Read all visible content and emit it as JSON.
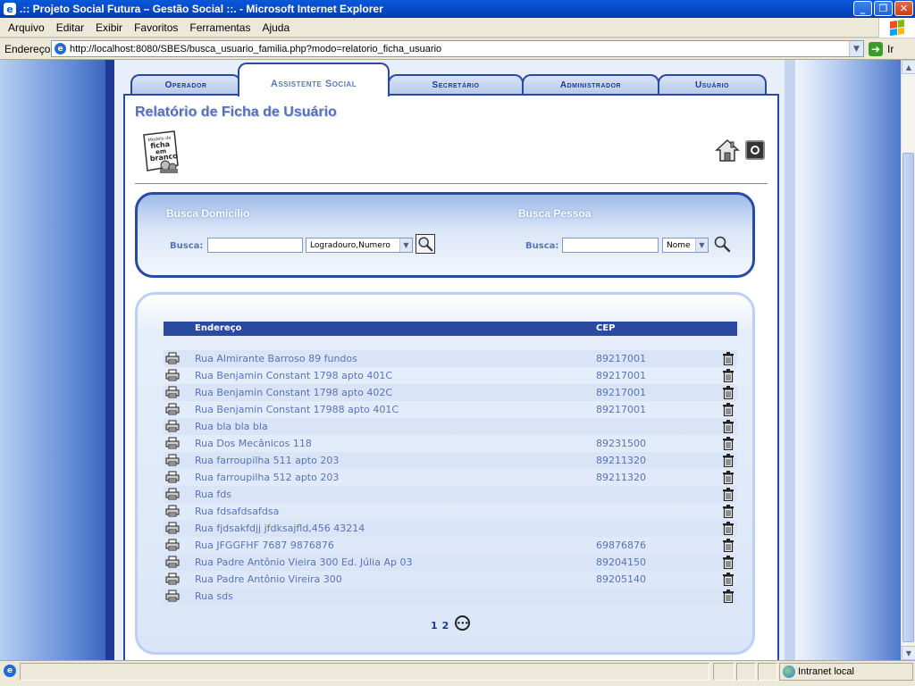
{
  "window": {
    "title": ".:: Projeto Social Futura – Gestão Social ::. - Microsoft Internet Explorer",
    "controls": {
      "minimize": "_",
      "restore": "❐",
      "close": "✕"
    }
  },
  "menu": [
    "Arquivo",
    "Editar",
    "Exibir",
    "Favoritos",
    "Ferramentas",
    "Ajuda"
  ],
  "address": {
    "label": "Endereço",
    "url": "http://localhost:8080/SBES/busca_usuario_familia.php?modo=relatorio_ficha_usuario",
    "go_label": "Ir"
  },
  "tabs": [
    {
      "label": "Operador"
    },
    {
      "label": "Assistente Social",
      "active": true
    },
    {
      "label": "Secretário"
    },
    {
      "label": "Administrador"
    },
    {
      "label": "Usuário"
    }
  ],
  "page": {
    "title": "Relatório de Ficha de Usuário",
    "doc_icon_text": [
      "Modelo de",
      "ficha",
      "em",
      "branco"
    ]
  },
  "search": {
    "domicilio": {
      "heading": "Busca Domicílio",
      "label": "Busca:",
      "value": "",
      "select_value": "Logradouro,Numero"
    },
    "pessoa": {
      "heading": "Busca Pessoa",
      "label": "Busca:",
      "value": "",
      "select_value": "Nome"
    }
  },
  "table": {
    "headers": {
      "address": "Endereço",
      "cep": "CEP"
    },
    "rows": [
      {
        "address": "Rua Almirante Barroso 89 fundos",
        "cep": "89217001"
      },
      {
        "address": "Rua Benjamin Constant 1798 apto 401C",
        "cep": "89217001"
      },
      {
        "address": "Rua Benjamin Constant 1798 apto 402C",
        "cep": "89217001"
      },
      {
        "address": "Rua Benjamin Constant 17988 apto 401C",
        "cep": "89217001"
      },
      {
        "address": "Rua bla bla bla",
        "cep": ""
      },
      {
        "address": "Rua Dos Mecânicos 118",
        "cep": "89231500"
      },
      {
        "address": "Rua farroupilha 511 apto 203",
        "cep": "89211320"
      },
      {
        "address": "Rua farroupilha 512 apto 203",
        "cep": "89211320"
      },
      {
        "address": "Rua fds",
        "cep": ""
      },
      {
        "address": "Rua fdsafdsafdsa",
        "cep": ""
      },
      {
        "address": "Rua fjdsakfdjj jfdksajfld,456 43214",
        "cep": ""
      },
      {
        "address": "Rua JFGGFHF 7687 9876876",
        "cep": "69876876"
      },
      {
        "address": "Rua Padre Antônio Vieira 300 Ed. Júlia Ap 03",
        "cep": "89204150"
      },
      {
        "address": "Rua Padre Antônio Vireira 300",
        "cep": "89205140"
      },
      {
        "address": "Rua sds",
        "cep": ""
      }
    ]
  },
  "pagination": {
    "pages": [
      "1",
      "2"
    ],
    "next": "•••"
  },
  "status": {
    "zone": "Intranet local"
  },
  "colors": {
    "navy": "#2a4aa2",
    "link": "#5a74b8",
    "row_alt": "#d9e4f7"
  }
}
